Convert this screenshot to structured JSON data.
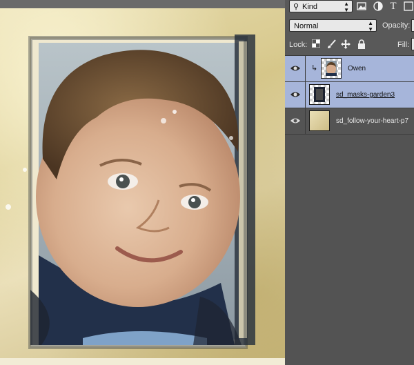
{
  "layers_panel": {
    "kind_filter": {
      "icon": "search-icon",
      "label": "Kind"
    },
    "filter_icons": [
      "image-filter-icon",
      "adjustment-filter-icon",
      "type-filter-icon",
      "shape-filter-icon"
    ],
    "type_filter_glyph": "T",
    "blend_mode": "Normal",
    "opacity_label": "Opacity:",
    "lock_label": "Lock:",
    "lock_icons": [
      "lock-transparent-icon",
      "lock-brush-icon",
      "lock-move-icon",
      "lock-all-icon"
    ],
    "fill_label": "Fill:",
    "layers": [
      {
        "name": "Owen",
        "selected": true,
        "clipped": true,
        "thumbnail": "photo-thumbnail"
      },
      {
        "name": "sd_masks-garden3",
        "selected": true,
        "clipped": false,
        "thumbnail": "mask-thumbnail"
      },
      {
        "name": "sd_follow-your-heart-p7",
        "selected": false,
        "clipped": false,
        "thumbnail": "paper-thumbnail"
      }
    ]
  },
  "colors": {
    "panel_bg": "#535353",
    "selected_layer": "#a6b5da",
    "paper": "#e2d6a6"
  }
}
